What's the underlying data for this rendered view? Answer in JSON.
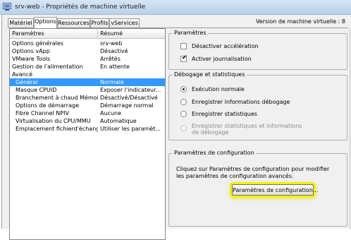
{
  "window": {
    "title": "srv-web - Propriétés de machine virtuelle",
    "vm_version": "Version de machine virtuelle : 8"
  },
  "tabs": [
    {
      "label": "Matériel",
      "active": false
    },
    {
      "label": "Options",
      "active": true
    },
    {
      "label": "Ressources",
      "active": false
    },
    {
      "label": "Profils",
      "active": false
    },
    {
      "label": "vServices",
      "active": false
    }
  ],
  "list": {
    "headers": {
      "param": "Paramètres",
      "summary": "Résumé"
    },
    "rows": [
      {
        "param": "Options générales",
        "summary": "srv-web"
      },
      {
        "param": "Options vApp",
        "summary": "Désactivé"
      },
      {
        "param": "VMware Tools",
        "summary": "Arrêtés"
      },
      {
        "param": "Gestion de l'alimentation",
        "summary": "En attente"
      },
      {
        "param": "Avancé",
        "summary": ""
      },
      {
        "param": "Général",
        "summary": "Normale",
        "selected": true
      },
      {
        "param": "Masque CPUID",
        "summary": "Exposer l'indicateur..."
      },
      {
        "param": "Branchement à chaud Mémoir...",
        "summary": "Désactivé/Désactivé"
      },
      {
        "param": "Options de démarrage",
        "summary": "Démarrage normal"
      },
      {
        "param": "Fibre Channel NPIV",
        "summary": "Aucune"
      },
      {
        "param": "Virtualisation du CPU/MMU",
        "summary": "Automatique"
      },
      {
        "param": "Emplacement fichierd'échange",
        "summary": "Utiliser les paramèt..."
      }
    ]
  },
  "settings_group": {
    "title": "Paramètres",
    "disable_acceleration": {
      "label": "Désactiver accélération",
      "checked": false
    },
    "enable_logging": {
      "label": "Activer journalisation",
      "checked": true
    }
  },
  "debug_group": {
    "title": "Débogage et statistiques",
    "options": [
      {
        "label": "Exécution normale",
        "selected": true,
        "enabled": true
      },
      {
        "label": "Enregistrer informations débogage",
        "selected": false,
        "enabled": true
      },
      {
        "label": "Enregistrer statistiques",
        "selected": false,
        "enabled": true
      },
      {
        "label_line1": "Enregistrer statistiques et informations",
        "label_line2": "de débogage",
        "selected": false,
        "enabled": false
      }
    ]
  },
  "config_group": {
    "title": "Paramètres de configuration",
    "description_line1": "Cliquez sur Paramètres de configuration pour modifier",
    "description_line2": "les paramètres de configuration avancés.",
    "button_label": "Paramètres de configuration...",
    "highlight_color": "#f5f000"
  }
}
